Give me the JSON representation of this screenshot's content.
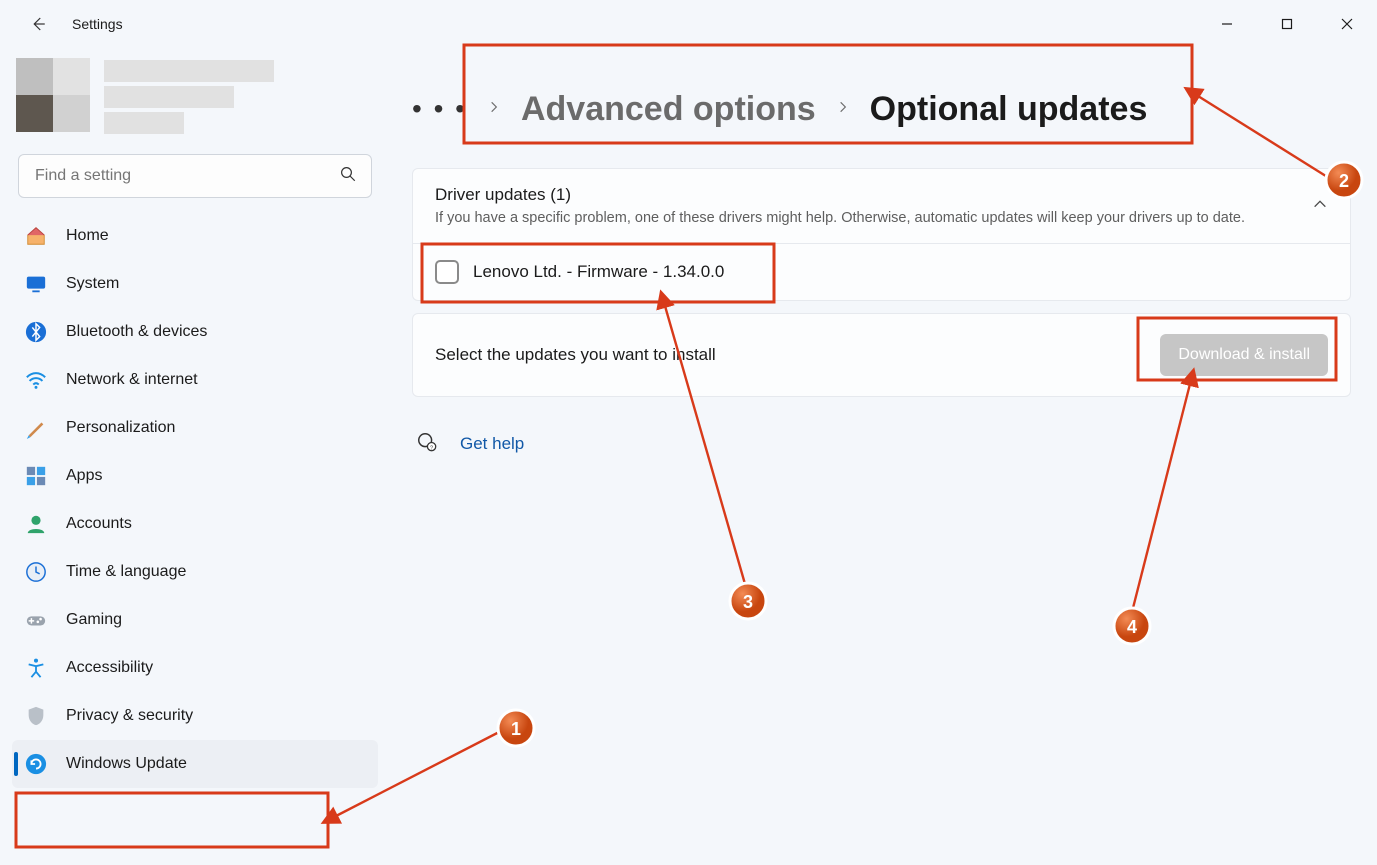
{
  "window": {
    "back_aria": "Back",
    "title": "Settings",
    "minimize": "Minimize",
    "maximize": "Maximize",
    "close": "Close"
  },
  "search": {
    "placeholder": "Find a setting"
  },
  "sidebar": {
    "items": [
      {
        "label": "Home"
      },
      {
        "label": "System"
      },
      {
        "label": "Bluetooth & devices"
      },
      {
        "label": "Network & internet"
      },
      {
        "label": "Personalization"
      },
      {
        "label": "Apps"
      },
      {
        "label": "Accounts"
      },
      {
        "label": "Time & language"
      },
      {
        "label": "Gaming"
      },
      {
        "label": "Accessibility"
      },
      {
        "label": "Privacy & security"
      },
      {
        "label": "Windows Update"
      }
    ]
  },
  "breadcrumb": {
    "ellipsis": "• • •",
    "parent": "Advanced options",
    "current": "Optional updates"
  },
  "driver_section": {
    "title": "Driver updates (1)",
    "subtitle": "If you have a specific problem, one of these drivers might help. Otherwise, automatic updates will keep your drivers up to date.",
    "items": [
      {
        "label": "Lenovo Ltd. - Firmware - 1.34.0.0"
      }
    ]
  },
  "install_bar": {
    "message": "Select the updates you want to install",
    "button": "Download & install"
  },
  "help": {
    "label": "Get help"
  },
  "annotations": {
    "n1": "1",
    "n2": "2",
    "n3": "3",
    "n4": "4"
  }
}
